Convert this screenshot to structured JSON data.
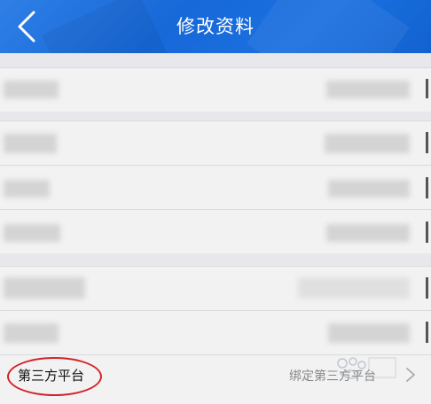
{
  "header": {
    "title": "修改资料",
    "back_icon": "chevron-left-icon"
  },
  "third_party": {
    "label": "第三方平台",
    "value": "绑定第三方平台",
    "arrow_icon": "chevron-right-icon"
  },
  "colors": {
    "header": "#1b70e0",
    "highlight_circle": "#d2232a"
  }
}
